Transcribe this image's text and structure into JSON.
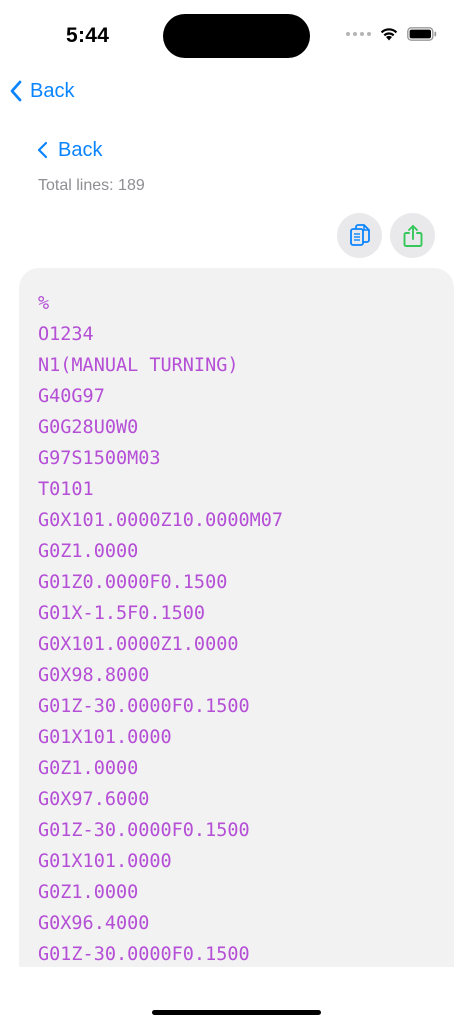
{
  "status_bar": {
    "time": "5:44",
    "icons": [
      "signal-icon",
      "wifi-icon",
      "battery-icon"
    ]
  },
  "nav": {
    "back_label": "Back"
  },
  "content": {
    "back_label": "Back",
    "total_lines": "Total lines: 189"
  },
  "actions": {
    "copy_icon": "copy-icon",
    "share_icon": "share-icon",
    "copy_color": "#0a84ff",
    "share_color": "#34c759"
  },
  "code_lines": [
    "%",
    "O1234",
    "N1(MANUAL TURNING)",
    "G40G97",
    "G0G28U0W0",
    "G97S1500M03",
    "T0101",
    "G0X101.0000Z10.0000M07",
    "G0Z1.0000",
    "G01Z0.0000F0.1500",
    "G01X-1.5F0.1500",
    "G0X101.0000Z1.0000",
    "G0X98.8000",
    "G01Z-30.0000F0.1500",
    "G01X101.0000",
    "G0Z1.0000",
    "G0X97.6000",
    "G01Z-30.0000F0.1500",
    "G01X101.0000",
    "G0Z1.0000",
    "G0X96.4000",
    "G01Z-30.0000F0.1500"
  ],
  "colors": {
    "accent": "#0a84ff",
    "code_text": "#b44fd6",
    "code_background": "#f2f2f2"
  }
}
